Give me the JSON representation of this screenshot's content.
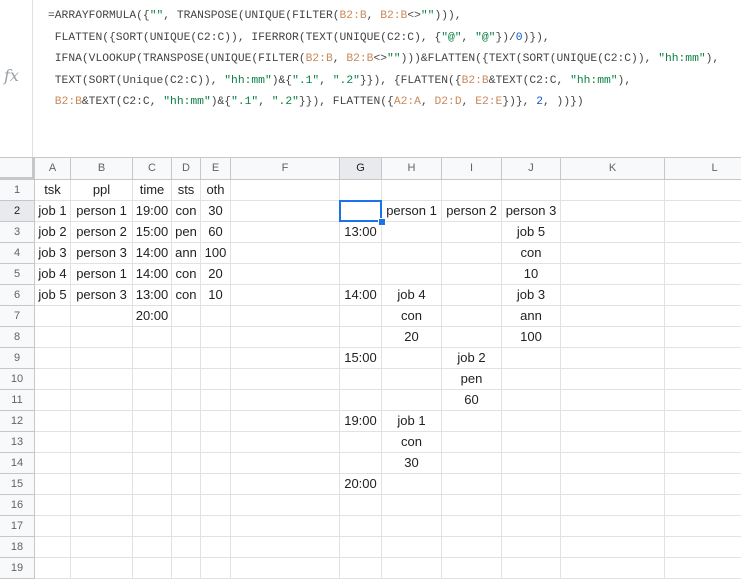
{
  "formula_bar": {
    "fx_label": "fx",
    "lines": [
      [
        [
          "t",
          "=ARRAYFORMULA({"
        ],
        [
          "s",
          "\"\""
        ],
        [
          "t",
          ", TRANSPOSE(UNIQUE(FILTER("
        ],
        [
          "r",
          "B2:B"
        ],
        [
          "t",
          ", "
        ],
        [
          "r",
          "B2:B"
        ],
        [
          "t",
          "<>"
        ],
        [
          "s",
          "\"\""
        ],
        [
          "t",
          "))),"
        ]
      ],
      [
        [
          "t",
          " FLATTEN({SORT(UNIQUE(C2:C)), IFERROR(TEXT(UNIQUE(C2:C), {"
        ],
        [
          "s",
          "\"@\""
        ],
        [
          "t",
          ", "
        ],
        [
          "s",
          "\"@\""
        ],
        [
          "t",
          "})/"
        ],
        [
          "n",
          "0"
        ],
        [
          "t",
          ")}),"
        ]
      ],
      [
        [
          "t",
          " IFNA(VLOOKUP(TRANSPOSE(UNIQUE(FILTER("
        ],
        [
          "r",
          "B2:B"
        ],
        [
          "t",
          ", "
        ],
        [
          "r",
          "B2:B"
        ],
        [
          "t",
          "<>"
        ],
        [
          "s",
          "\"\""
        ],
        [
          "t",
          ")))&FLATTEN({TEXT(SORT(UNIQUE(C2:C)), "
        ],
        [
          "s",
          "\"hh:mm\""
        ],
        [
          "t",
          "),"
        ]
      ],
      [
        [
          "t",
          " TEXT(SORT(Unique(C2:C)), "
        ],
        [
          "s",
          "\"hh:mm\""
        ],
        [
          "t",
          ")&{"
        ],
        [
          "s",
          "\".1\""
        ],
        [
          "t",
          ", "
        ],
        [
          "s",
          "\".2\""
        ],
        [
          "t",
          "}}), {FLATTEN({"
        ],
        [
          "r",
          "B2:B"
        ],
        [
          "t",
          "&TEXT(C2:C, "
        ],
        [
          "s",
          "\"hh:mm\""
        ],
        [
          "t",
          "),"
        ]
      ],
      [
        [
          "t",
          " "
        ],
        [
          "r",
          "B2:B"
        ],
        [
          "t",
          "&TEXT(C2:C, "
        ],
        [
          "s",
          "\"hh:mm\""
        ],
        [
          "t",
          ")&{"
        ],
        [
          "s",
          "\".1\""
        ],
        [
          "t",
          ", "
        ],
        [
          "s",
          "\".2\""
        ],
        [
          "t",
          "}}), FLATTEN({"
        ],
        [
          "r",
          "A2:A"
        ],
        [
          "t",
          ", "
        ],
        [
          "r",
          "D2:D"
        ],
        [
          "t",
          ", "
        ],
        [
          "r",
          "E2:E"
        ],
        [
          "t",
          "})}, "
        ],
        [
          "n",
          "2"
        ],
        [
          "t",
          ", ))})"
        ]
      ]
    ]
  },
  "columns": [
    "A",
    "B",
    "C",
    "D",
    "E",
    "F",
    "G",
    "H",
    "I",
    "J",
    "K",
    "L"
  ],
  "selected_column": "G",
  "selected_row": 2,
  "rows": [
    {
      "n": "1",
      "cells": {
        "A": "tsk",
        "B": "ppl",
        "C": "time",
        "D": "sts",
        "E": "oth"
      }
    },
    {
      "n": "2",
      "cells": {
        "A": "job 1",
        "B": "person 1",
        "C": "19:00",
        "D": "con",
        "E": "30",
        "H": "person 1",
        "I": "person 2",
        "J": "person 3"
      }
    },
    {
      "n": "3",
      "cells": {
        "A": "job 2",
        "B": "person 2",
        "C": "15:00",
        "D": "pen",
        "E": "60",
        "G": "13:00",
        "J": "job 5"
      }
    },
    {
      "n": "4",
      "cells": {
        "A": "job 3",
        "B": "person 3",
        "C": "14:00",
        "D": "ann",
        "E": "100",
        "J": "con"
      }
    },
    {
      "n": "5",
      "cells": {
        "A": "job 4",
        "B": "person 1",
        "C": "14:00",
        "D": "con",
        "E": "20",
        "J": "10"
      }
    },
    {
      "n": "6",
      "cells": {
        "A": "job 5",
        "B": "person 3",
        "C": "13:00",
        "D": "con",
        "E": "10",
        "G": "14:00",
        "H": "job 4",
        "J": "job 3"
      }
    },
    {
      "n": "7",
      "cells": {
        "C": "20:00",
        "H": "con",
        "J": "ann"
      }
    },
    {
      "n": "8",
      "cells": {
        "H": "20",
        "J": "100"
      }
    },
    {
      "n": "9",
      "cells": {
        "G": "15:00",
        "I": "job 2"
      }
    },
    {
      "n": "10",
      "cells": {
        "I": "pen"
      }
    },
    {
      "n": "11",
      "cells": {
        "I": "60"
      }
    },
    {
      "n": "12",
      "cells": {
        "G": "19:00",
        "H": "job 1"
      }
    },
    {
      "n": "13",
      "cells": {
        "H": "con"
      }
    },
    {
      "n": "14",
      "cells": {
        "H": "30"
      }
    },
    {
      "n": "15",
      "cells": {
        "G": "20:00"
      }
    },
    {
      "n": "16",
      "cells": {}
    },
    {
      "n": "17",
      "cells": {}
    },
    {
      "n": "18",
      "cells": {}
    },
    {
      "n": "19",
      "cells": {}
    }
  ],
  "colors": {
    "selection": "#1a73e8",
    "range_ref": "#c9885a",
    "string_literal": "#0b8043"
  }
}
